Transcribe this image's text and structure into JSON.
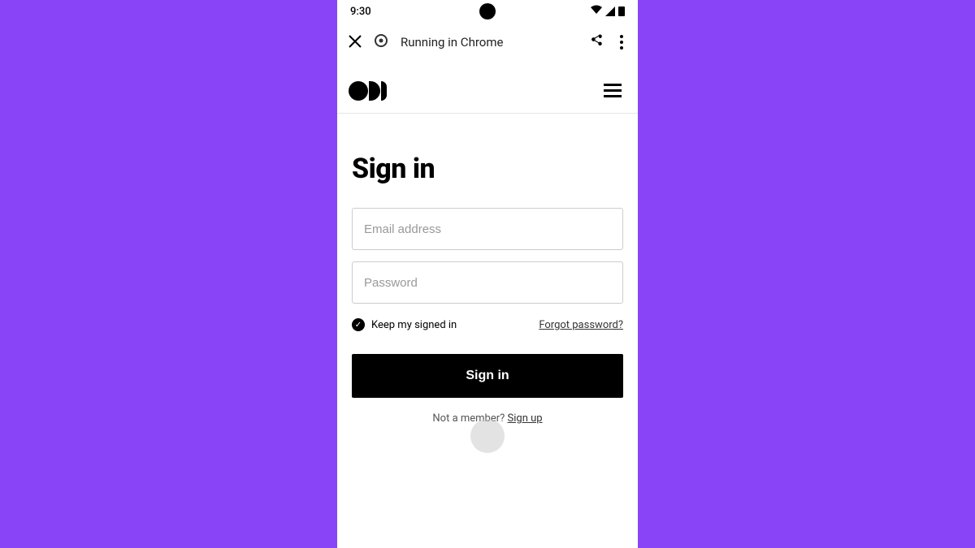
{
  "statusBar": {
    "time": "9:30"
  },
  "chromeBar": {
    "title": "Running in Chrome"
  },
  "page": {
    "heading": "Sign in",
    "emailPlaceholder": "Email address",
    "passwordPlaceholder": "Password",
    "keepSignedInLabel": "Keep my signed in",
    "forgotPasswordLabel": "Forgot password?",
    "submitLabel": "Sign in",
    "notMemberText": "Not a member? ",
    "signupLabel": "Sign up"
  }
}
